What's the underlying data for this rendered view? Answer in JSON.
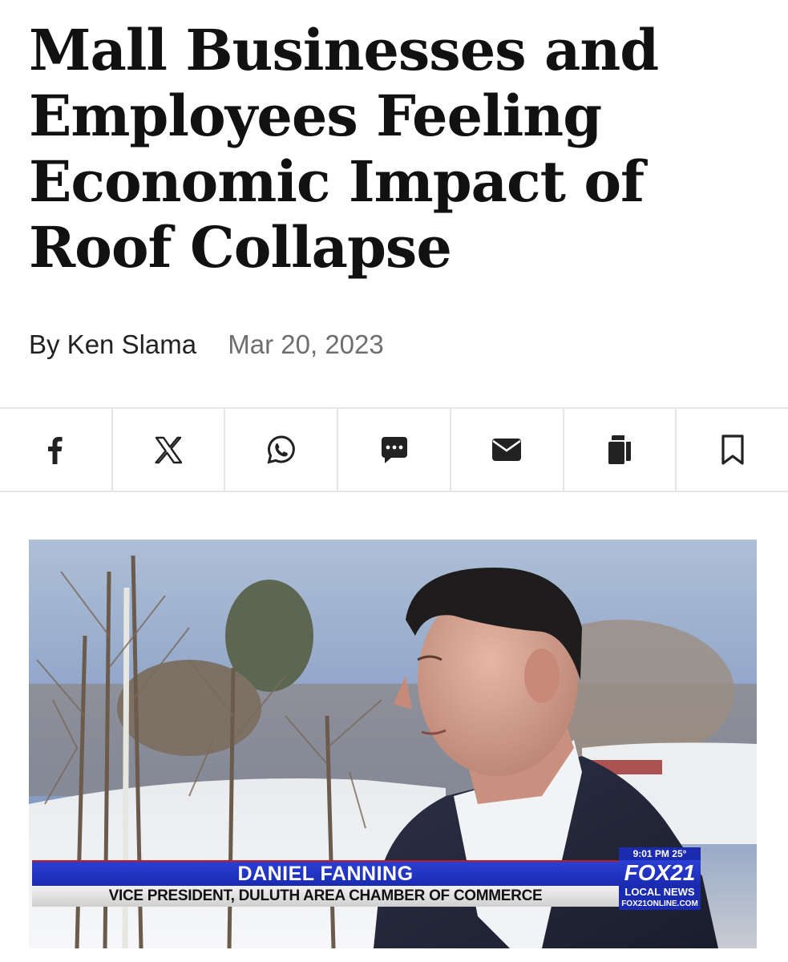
{
  "article": {
    "headline": "Mall Businesses and Employees Feeling Economic Impact of Roof Collapse",
    "author": "By Ken Slama",
    "date": "Mar 20, 2023"
  },
  "share_bar": [
    {
      "name": "facebook-icon"
    },
    {
      "name": "x-icon"
    },
    {
      "name": "whatsapp-icon"
    },
    {
      "name": "sms-icon"
    },
    {
      "name": "email-icon"
    },
    {
      "name": "copy-icon"
    },
    {
      "name": "bookmark-icon"
    }
  ],
  "photo": {
    "lower_third_name": "DANIEL FANNING",
    "lower_third_title": "VICE PRESIDENT, DULUTH AREA CHAMBER OF COMMERCE",
    "time_temp": "9:01 PM  25°",
    "logo_text": "FOX21",
    "logo_sub": "LOCAL NEWS",
    "logo_url": "FOX21ONLINE.COM"
  },
  "colors": {
    "text": "#111111",
    "date_gray": "#6e6e6e",
    "divider": "#e6e6e6",
    "broadcast_blue": "#1a2bb0"
  }
}
